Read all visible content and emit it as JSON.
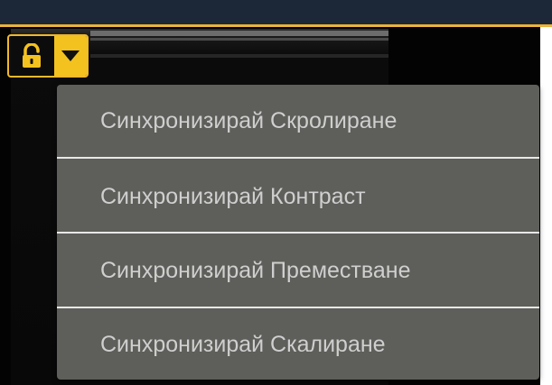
{
  "colors": {
    "top_bar": "#1c2838",
    "accent": "#e9b33a",
    "lock_button_arrow": "#f3c21f",
    "menu_background": "#5e5e5a",
    "menu_text": "#cfcfcf"
  },
  "lock_button": {
    "icon": "unlocked-padlock-icon",
    "dropdown_icon": "caret-down-icon"
  },
  "sync_menu": {
    "items": [
      {
        "label": "Синхронизирай Скролиране"
      },
      {
        "label": "Синхронизирай Контраст"
      },
      {
        "label": "Синхронизирай Преместване"
      },
      {
        "label": "Синхронизирай Скалиране"
      }
    ]
  }
}
